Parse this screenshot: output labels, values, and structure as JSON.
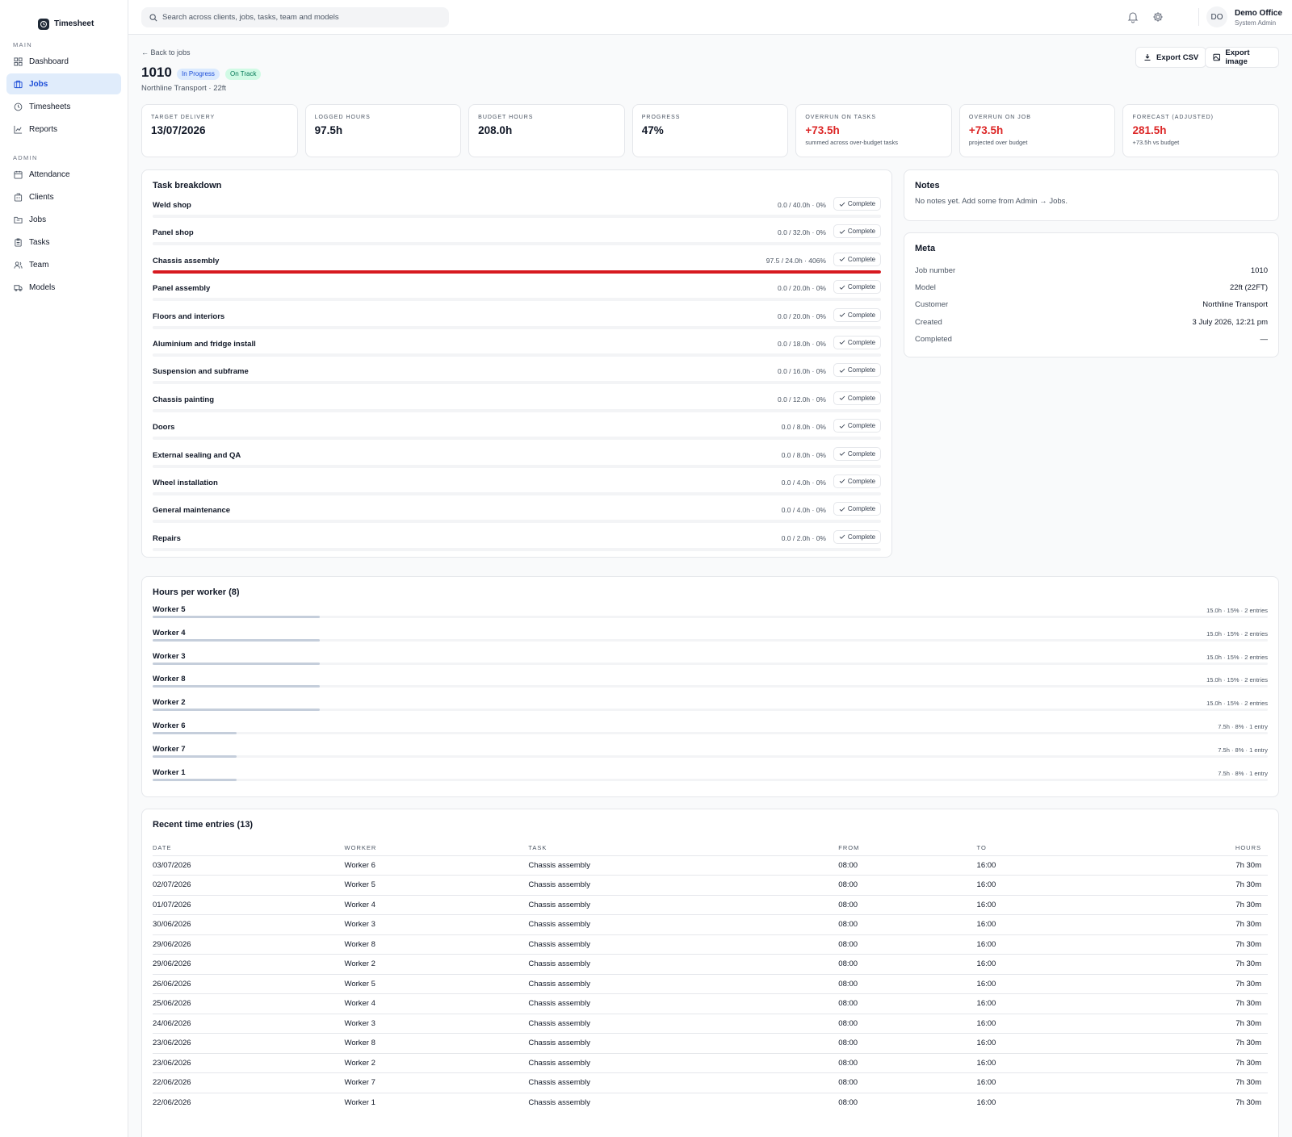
{
  "app": {
    "name": "Timesheet"
  },
  "sidebar": {
    "main_label": "MAIN",
    "admin_label": "ADMIN",
    "main_items": [
      {
        "label": "Dashboard",
        "icon": "dashboard-icon",
        "active": false
      },
      {
        "label": "Jobs",
        "icon": "briefcase-icon",
        "active": true
      },
      {
        "label": "Timesheets",
        "icon": "clock-icon",
        "active": false
      },
      {
        "label": "Reports",
        "icon": "chart-icon",
        "active": false
      }
    ],
    "admin_items": [
      {
        "label": "Attendance",
        "icon": "calendar-icon"
      },
      {
        "label": "Clients",
        "icon": "building-icon"
      },
      {
        "label": "Jobs",
        "icon": "folder-icon"
      },
      {
        "label": "Tasks",
        "icon": "clipboard-icon"
      },
      {
        "label": "Team",
        "icon": "users-icon"
      },
      {
        "label": "Models",
        "icon": "truck-icon"
      }
    ]
  },
  "topbar": {
    "search_placeholder": "Search across clients, jobs, tasks, team and models",
    "avatar_initials": "DO",
    "user_name": "Demo Office",
    "user_role": "System Admin"
  },
  "job": {
    "back_label": "← Back to jobs",
    "number": "1010",
    "status_badge": "In Progress",
    "track_badge": "On Track",
    "subtitle": "Northline Transport · 22ft",
    "export_csv": "Export CSV",
    "export_image": "Export image"
  },
  "stats": [
    {
      "label": "TARGET DELIVERY",
      "value": "13/07/2026",
      "sub": "",
      "red": false
    },
    {
      "label": "LOGGED HOURS",
      "value": "97.5h",
      "sub": "",
      "red": false
    },
    {
      "label": "BUDGET HOURS",
      "value": "208.0h",
      "sub": "",
      "red": false
    },
    {
      "label": "PROGRESS",
      "value": "47%",
      "sub": "",
      "red": false
    },
    {
      "label": "OVERRUN ON TASKS",
      "value": "+73.5h",
      "sub": "summed across over-budget tasks",
      "red": true
    },
    {
      "label": "OVERRUN ON JOB",
      "value": "+73.5h",
      "sub": "projected over budget",
      "red": true
    },
    {
      "label": "FORECAST (ADJUSTED)",
      "value": "281.5h",
      "sub": "+73.5h vs budget",
      "red": true
    }
  ],
  "tasks": {
    "title": "Task breakdown",
    "complete_label": "Complete",
    "bar_color": "#d71920",
    "items": [
      {
        "name": "Weld shop",
        "meta": "0.0 / 40.0h · 0%",
        "progress": 0
      },
      {
        "name": "Panel shop",
        "meta": "0.0 / 32.0h · 0%",
        "progress": 0
      },
      {
        "name": "Chassis assembly",
        "meta": "97.5 / 24.0h · 406%",
        "progress": 100
      },
      {
        "name": "Panel assembly",
        "meta": "0.0 / 20.0h · 0%",
        "progress": 0
      },
      {
        "name": "Floors and interiors",
        "meta": "0.0 / 20.0h · 0%",
        "progress": 0
      },
      {
        "name": "Aluminium and fridge install",
        "meta": "0.0 / 18.0h · 0%",
        "progress": 0
      },
      {
        "name": "Suspension and subframe",
        "meta": "0.0 / 16.0h · 0%",
        "progress": 0
      },
      {
        "name": "Chassis painting",
        "meta": "0.0 / 12.0h · 0%",
        "progress": 0
      },
      {
        "name": "Doors",
        "meta": "0.0 / 8.0h · 0%",
        "progress": 0
      },
      {
        "name": "External sealing and QA",
        "meta": "0.0 / 8.0h · 0%",
        "progress": 0
      },
      {
        "name": "Wheel installation",
        "meta": "0.0 / 4.0h · 0%",
        "progress": 0
      },
      {
        "name": "General maintenance",
        "meta": "0.0 / 4.0h · 0%",
        "progress": 0
      },
      {
        "name": "Repairs",
        "meta": "0.0 / 2.0h · 0%",
        "progress": 0
      }
    ]
  },
  "notes": {
    "title": "Notes",
    "text": "No notes yet. Add some from Admin → Jobs."
  },
  "meta": {
    "title": "Meta",
    "rows": [
      {
        "k": "Job number",
        "v": "1010"
      },
      {
        "k": "Model",
        "v": "22ft (22FT)"
      },
      {
        "k": "Customer",
        "v": "Northline Transport"
      },
      {
        "k": "Created",
        "v": "3 July 2026, 12:21 pm"
      },
      {
        "k": "Completed",
        "v": "—"
      }
    ]
  },
  "workers": {
    "title": "Hours per worker (8)",
    "items": [
      {
        "name": "Worker 5",
        "meta": "15.0h · 15% · 2 entries",
        "share": 15
      },
      {
        "name": "Worker 4",
        "meta": "15.0h · 15% · 2 entries",
        "share": 15
      },
      {
        "name": "Worker 3",
        "meta": "15.0h · 15% · 2 entries",
        "share": 15
      },
      {
        "name": "Worker 8",
        "meta": "15.0h · 15% · 2 entries",
        "share": 15
      },
      {
        "name": "Worker 2",
        "meta": "15.0h · 15% · 2 entries",
        "share": 15
      },
      {
        "name": "Worker 6",
        "meta": "7.5h · 8% · 1 entry",
        "share": 7.5
      },
      {
        "name": "Worker 7",
        "meta": "7.5h · 8% · 1 entry",
        "share": 7.5
      },
      {
        "name": "Worker 1",
        "meta": "7.5h · 8% · 1 entry",
        "share": 7.5
      }
    ]
  },
  "entries": {
    "title": "Recent time entries (13)",
    "columns": [
      "DATE",
      "WORKER",
      "TASK",
      "FROM",
      "TO",
      "HOURS"
    ],
    "rows": [
      [
        "03/07/2026",
        "Worker 6",
        "Chassis assembly",
        "08:00",
        "16:00",
        "7h 30m"
      ],
      [
        "02/07/2026",
        "Worker 5",
        "Chassis assembly",
        "08:00",
        "16:00",
        "7h 30m"
      ],
      [
        "01/07/2026",
        "Worker 4",
        "Chassis assembly",
        "08:00",
        "16:00",
        "7h 30m"
      ],
      [
        "30/06/2026",
        "Worker 3",
        "Chassis assembly",
        "08:00",
        "16:00",
        "7h 30m"
      ],
      [
        "29/06/2026",
        "Worker 8",
        "Chassis assembly",
        "08:00",
        "16:00",
        "7h 30m"
      ],
      [
        "29/06/2026",
        "Worker 2",
        "Chassis assembly",
        "08:00",
        "16:00",
        "7h 30m"
      ],
      [
        "26/06/2026",
        "Worker 5",
        "Chassis assembly",
        "08:00",
        "16:00",
        "7h 30m"
      ],
      [
        "25/06/2026",
        "Worker 4",
        "Chassis assembly",
        "08:00",
        "16:00",
        "7h 30m"
      ],
      [
        "24/06/2026",
        "Worker 3",
        "Chassis assembly",
        "08:00",
        "16:00",
        "7h 30m"
      ],
      [
        "23/06/2026",
        "Worker 8",
        "Chassis assembly",
        "08:00",
        "16:00",
        "7h 30m"
      ],
      [
        "23/06/2026",
        "Worker 2",
        "Chassis assembly",
        "08:00",
        "16:00",
        "7h 30m"
      ],
      [
        "22/06/2026",
        "Worker 7",
        "Chassis assembly",
        "08:00",
        "16:00",
        "7h 30m"
      ],
      [
        "22/06/2026",
        "Worker 1",
        "Chassis assembly",
        "08:00",
        "16:00",
        "7h 30m"
      ]
    ]
  }
}
